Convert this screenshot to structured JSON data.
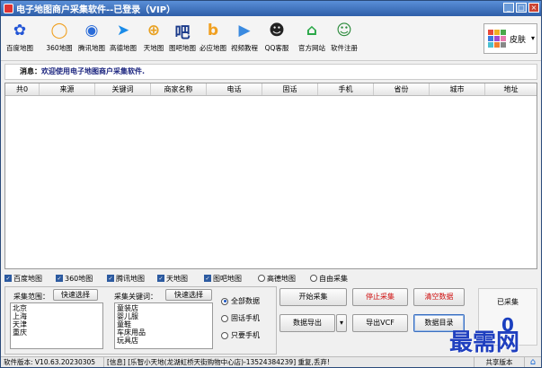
{
  "window": {
    "title": "电子地图商户采集软件--已登录（VIP）",
    "controls": [
      "_",
      "□",
      "×"
    ]
  },
  "toolbar": {
    "items": [
      {
        "label": "百度地图",
        "icon": "baidu-paw-icon",
        "glyph": "✿",
        "color": "#2456d6"
      },
      {
        "label": "360地图",
        "icon": "360-ring-icon",
        "glyph": "◯",
        "color": "#f0a020"
      },
      {
        "label": "腾讯地图",
        "icon": "tencent-swirl-icon",
        "glyph": "◉",
        "color": "#2a6bd8"
      },
      {
        "label": "高德地图",
        "icon": "gaode-arrow-icon",
        "glyph": "➤",
        "color": "#1a8be8"
      },
      {
        "label": "天地图",
        "icon": "tianditu-globe-icon",
        "glyph": "⊕",
        "color": "#e8a020"
      },
      {
        "label": "图吧地图",
        "icon": "tuba-logo-icon",
        "glyph": "吧",
        "color": "#1a3a8a"
      },
      {
        "label": "必应地图",
        "icon": "bing-logo-icon",
        "glyph": "b",
        "color": "#f0a020"
      },
      {
        "label": "视频教程",
        "icon": "video-play-icon",
        "glyph": "▶",
        "color": "#3a8ae0"
      },
      {
        "label": "QQ客服",
        "icon": "qq-penguin-icon",
        "glyph": "☻",
        "color": "#222222"
      },
      {
        "label": "官方网站",
        "icon": "home-icon",
        "glyph": "⌂",
        "color": "#2aa848"
      },
      {
        "label": "软件注册",
        "icon": "user-register-icon",
        "glyph": "☺",
        "color": "#2a8a3a"
      }
    ],
    "skin": {
      "label": "皮肤",
      "colors": [
        "#e84a3a",
        "#f0b020",
        "#4aa84a",
        "#3a7ae0",
        "#a04ad0",
        "#e87ab0",
        "#4ac0d0",
        "#f08030",
        "#888888"
      ]
    }
  },
  "notice": {
    "label": "消息：",
    "text": "欢迎使用电子地图商户采集软件."
  },
  "table": {
    "columns": [
      "共0",
      "来源",
      "关键词",
      "商家名称",
      "电话",
      "固话",
      "手机",
      "省份",
      "城市",
      "地址"
    ]
  },
  "sources": {
    "items": [
      {
        "label": "百度地图",
        "type": "checkbox",
        "checked": true
      },
      {
        "label": "360地图",
        "type": "checkbox",
        "checked": true
      },
      {
        "label": "腾讯地图",
        "type": "checkbox",
        "checked": true
      },
      {
        "label": "天地图",
        "type": "checkbox",
        "checked": true
      },
      {
        "label": "图吧地图",
        "type": "checkbox",
        "checked": true
      },
      {
        "label": "高德地图",
        "type": "radio",
        "checked": false
      },
      {
        "label": "自由采集",
        "type": "radio",
        "checked": false
      }
    ]
  },
  "scope": {
    "label": "采集范围：",
    "quick_select": "快速选择",
    "cities": [
      "北京",
      "上海",
      "天津",
      "重庆"
    ]
  },
  "keywords": {
    "label": "采集关键词：",
    "quick_select": "快速选择",
    "items": [
      "童装店",
      "婴儿服",
      "童鞋",
      "车床用品",
      "玩具店"
    ]
  },
  "filter": {
    "options": [
      {
        "label": "全部数据",
        "selected": true
      },
      {
        "label": "固话手机",
        "selected": false
      },
      {
        "label": "只要手机",
        "selected": false
      }
    ]
  },
  "actions": {
    "start": "开始采集",
    "stop": "停止采集",
    "clear": "清空数据",
    "export": "数据导出",
    "export_vcf": "导出VCF",
    "data_dir": "数据目录"
  },
  "counter": {
    "label": "已采集",
    "value": "0"
  },
  "status": {
    "version": "软件版本: V10.63.20230305",
    "message": "[信息] [乐智小天地(龙湖虹桥天街购物中心店)-13524384239] 重复,丢弃!",
    "share": "共享版本"
  },
  "watermark": "最需网"
}
